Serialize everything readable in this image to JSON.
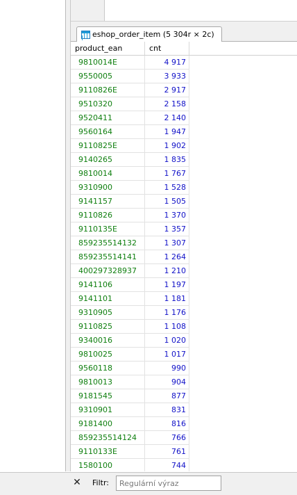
{
  "tab": {
    "label": "eshop_order_item (5 304r × 2c)",
    "icon": "table-grid-icon"
  },
  "grid": {
    "columns": [
      "product_ean",
      "cnt"
    ],
    "rows": [
      [
        "9810014E",
        "4 917"
      ],
      [
        "9550005",
        "3 933"
      ],
      [
        "9110826E",
        "2 917"
      ],
      [
        "9510320",
        "2 158"
      ],
      [
        "9520411",
        "2 140"
      ],
      [
        "9560164",
        "1 947"
      ],
      [
        "9110825E",
        "1 902"
      ],
      [
        "9140265",
        "1 835"
      ],
      [
        "9810014",
        "1 767"
      ],
      [
        "9310900",
        "1 528"
      ],
      [
        "9141157",
        "1 505"
      ],
      [
        "9110826",
        "1 370"
      ],
      [
        "9110135E",
        "1 357"
      ],
      [
        "859235514132",
        "1 307"
      ],
      [
        "859235514141",
        "1 264"
      ],
      [
        "400297328937",
        "1 210"
      ],
      [
        "9141106",
        "1 197"
      ],
      [
        "9141101",
        "1 181"
      ],
      [
        "9310905",
        "1 176"
      ],
      [
        "9110825",
        "1 108"
      ],
      [
        "9340016",
        "1 020"
      ],
      [
        "9810025",
        "1 017"
      ],
      [
        "9560118",
        "990"
      ],
      [
        "9810013",
        "904"
      ],
      [
        "9181545",
        "877"
      ],
      [
        "9310901",
        "831"
      ],
      [
        "9181400",
        "816"
      ],
      [
        "859235514124",
        "766"
      ],
      [
        "9110133E",
        "761"
      ],
      [
        "1580100",
        "744"
      ]
    ],
    "colors": {
      "ean": "#0f7f0f",
      "cnt": "#1010c8"
    }
  },
  "filter": {
    "close_glyph": "✕",
    "label": "Filtr:",
    "placeholder": "Regulární výraz",
    "value": ""
  }
}
